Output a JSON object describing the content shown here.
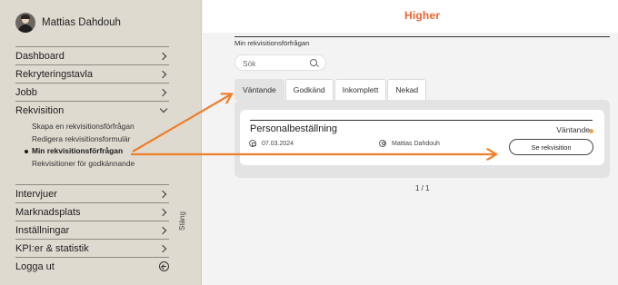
{
  "user": {
    "name": "Mattias Dahdouh"
  },
  "sidebar": {
    "top_items": [
      {
        "label": "Dashboard"
      },
      {
        "label": "Rekryteringstavla"
      },
      {
        "label": "Jobb"
      },
      {
        "label": "Rekvisition"
      }
    ],
    "sub_items": [
      {
        "label": "Skapa en rekvisitionsförfrågan"
      },
      {
        "label": "Redigera rekvisitionsformulär"
      },
      {
        "label": "Min rekvisitionsförfrågan"
      },
      {
        "label": "Rekvisitioner för godkännande"
      }
    ],
    "bottom_items": [
      {
        "label": "Intervjuer"
      },
      {
        "label": "Marknadsplats"
      },
      {
        "label": "Inställningar"
      },
      {
        "label": "KPI:er & statistik"
      },
      {
        "label": "Logga ut"
      }
    ],
    "close_label": "Stäng"
  },
  "header": {
    "brand": "Higher"
  },
  "main": {
    "section_title": "Min rekvisitionsförfrågan",
    "search_placeholder": "Sök",
    "tabs": [
      {
        "label": "Väntande"
      },
      {
        "label": "Godkänd"
      },
      {
        "label": "Inkomplett"
      },
      {
        "label": "Nekad"
      }
    ],
    "card": {
      "title": "Personalbeställning",
      "status": "Väntande",
      "status_color": "#f2a24a",
      "date": "07.03.2024",
      "requester": "Mattias Dahdouh",
      "button_label": "Se rekvisition"
    },
    "pagination": "1 / 1"
  },
  "colors": {
    "brand": "#f0622d",
    "annotation_arrow": "#ef7f2a"
  }
}
